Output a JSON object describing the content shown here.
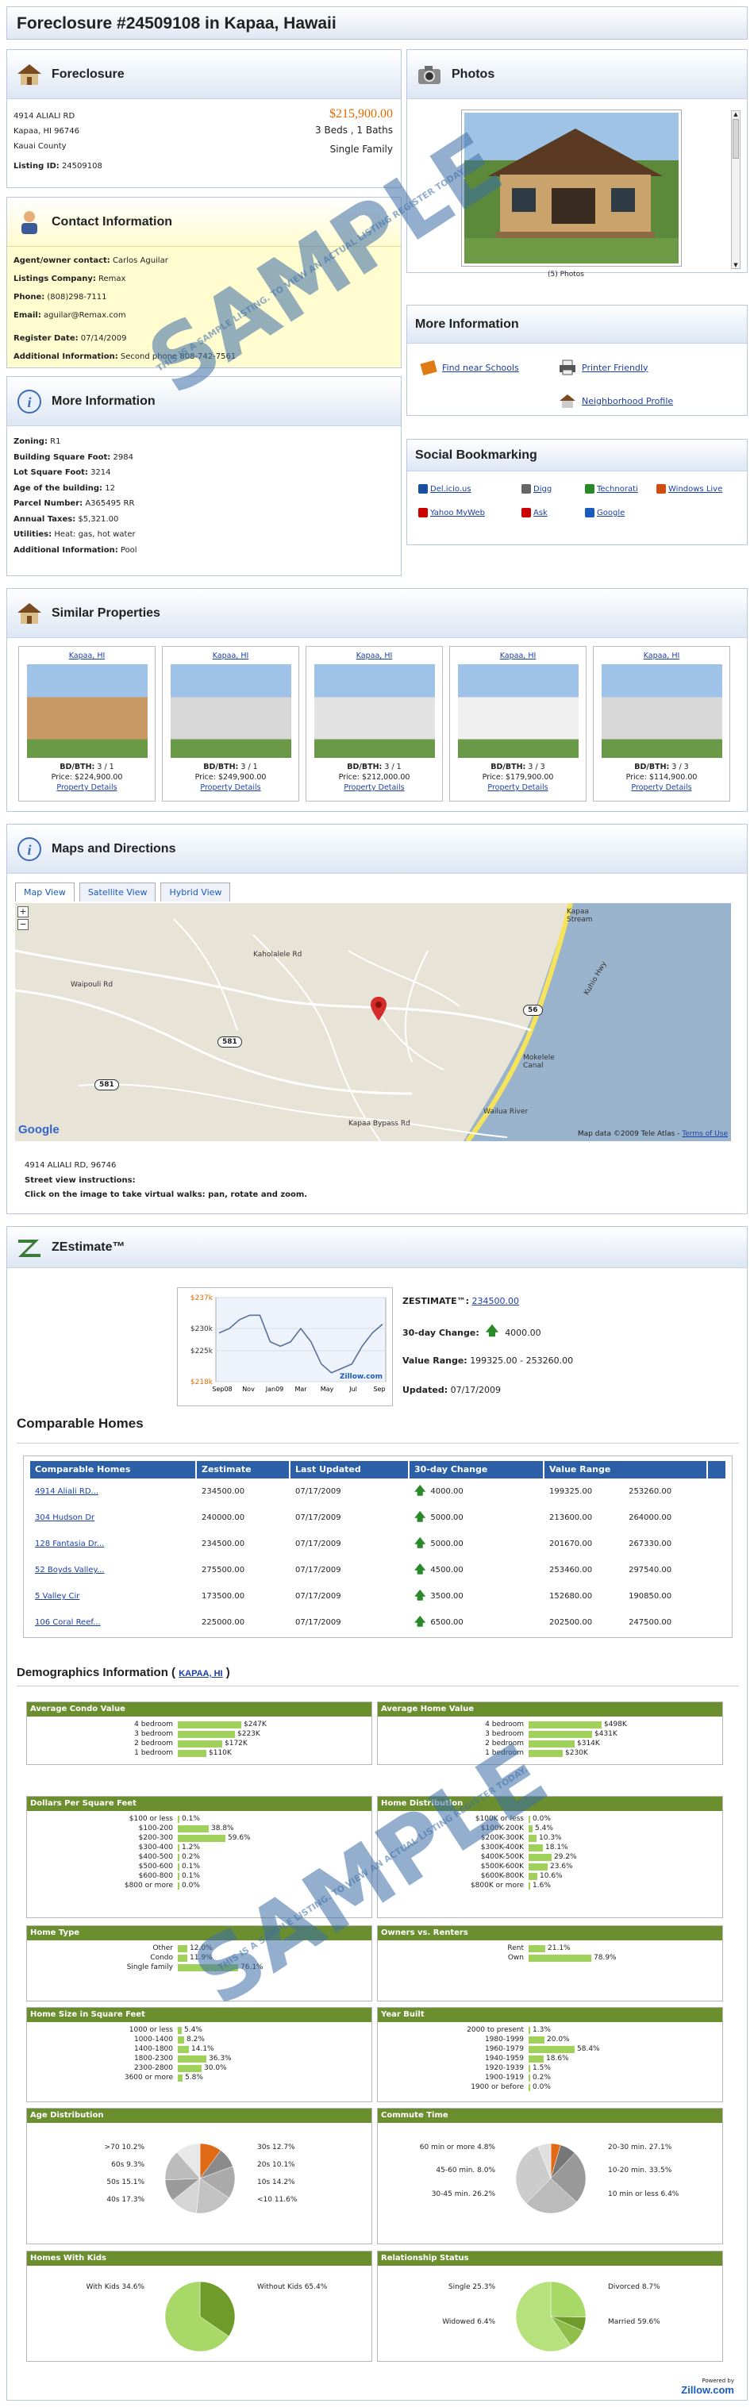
{
  "page_title": "Foreclosure #24509108 in Kapaa, Hawaii",
  "summary": {
    "header": "Foreclosure",
    "address1": "4914 ALIALI RD",
    "address2": "Kapaa, HI 96746",
    "county": "Kauai County",
    "listing_label": "Listing ID:",
    "listing_id": "24509108",
    "price": "$215,900.00",
    "beds_baths": "3 Beds , 1 Baths",
    "type": "Single Family"
  },
  "photos": {
    "header": "Photos",
    "caption": "(5) Photos"
  },
  "contact": {
    "header": "Contact Information",
    "rows": [
      {
        "label": "Agent/owner contact:",
        "value": "Carlos Aguilar"
      },
      {
        "label": "Listings Company:",
        "value": "Remax"
      },
      {
        "label": "Phone:",
        "value": "(808)298-7111"
      },
      {
        "label": "Email:",
        "value": "aguilar@Remax.com"
      },
      {
        "label": "Register Date:",
        "value": "07/14/2009"
      },
      {
        "label": "Additional Information:",
        "value": "Second phone 808-742-7561"
      }
    ]
  },
  "more_info_links": {
    "header": "More Information",
    "find_schools": "Find near Schools",
    "printer": "Printer Friendly",
    "neighborhood": "Neighborhood Profile"
  },
  "more_info": {
    "header": "More Information",
    "rows": [
      {
        "label": "Zoning:",
        "value": "R1"
      },
      {
        "label": "Building Square Foot:",
        "value": "2984"
      },
      {
        "label": "Lot Square Foot:",
        "value": "3214"
      },
      {
        "label": "Age of the building:",
        "value": "12"
      },
      {
        "label": "Parcel Number:",
        "value": "A365495 RR"
      },
      {
        "label": "Annual Taxes:",
        "value": "$5,321.00"
      },
      {
        "label": "Utilities:",
        "value": "Heat: gas, hot water"
      },
      {
        "label": "Additional Information:",
        "value": "Pool"
      }
    ]
  },
  "social": {
    "header": "Social Bookmarking",
    "items": [
      "Del.icio.us",
      "Digg",
      "Technorati",
      "Windows Live",
      "Yahoo MyWeb",
      "Ask",
      "Google"
    ]
  },
  "similar": {
    "header": "Similar Properties",
    "items": [
      {
        "city": "Kapaa, HI",
        "bdbth": "3 / 1",
        "price": "$224,900.00"
      },
      {
        "city": "Kapaa, HI",
        "bdbth": "3 / 1",
        "price": "$249,900.00"
      },
      {
        "city": "Kapaa, HI",
        "bdbth": "3 / 1",
        "price": "$212,000.00"
      },
      {
        "city": "Kapaa, HI",
        "bdbth": "3 / 3",
        "price": "$179,900.00"
      },
      {
        "city": "Kapaa, HI",
        "bdbth": "3 / 3",
        "price": "$114,900.00"
      }
    ],
    "bd_label": "BD/BTH:",
    "price_label": "Price:",
    "details_label": "Property Details"
  },
  "maps": {
    "header": "Maps and Directions",
    "tabs": [
      "Map View",
      "Satellite View",
      "Hybrid View"
    ],
    "labels": [
      "Kapaa Stream",
      "Kuhio Hwy",
      "Wailua River",
      "Waipouli Rd",
      "Kaholalele Rd",
      "Kapaa Bypass Rd",
      "Mokelele Canal"
    ],
    "road_badges": [
      "56",
      "581",
      "581"
    ],
    "copyright": "Map data ©2009 Tele Atlas -",
    "terms": "Terms of Use",
    "google": "Google",
    "address": "4914 ALIALI RD, 96746",
    "instructions_title": "Street view instructions:",
    "instructions": "Click on the image to take virtual walks: pan, rotate and zoom."
  },
  "zestimate": {
    "header": "ZEstimate™",
    "label": "ZESTIMATE™:",
    "value": "234500.00",
    "change_label": "30-day Change:",
    "change": "4000.00",
    "range_label": "Value Range:",
    "range": "199325.00 - 253260.00",
    "updated_label": "Updated:",
    "updated": "07/17/2009",
    "chart_brand": "Zillow.com"
  },
  "chart_data": {
    "type": "line",
    "x": [
      "Sep08",
      "Nov",
      "Jan09",
      "Mar",
      "May",
      "Jul",
      "Sep"
    ],
    "y_ticks": [
      "$237k",
      "$230k",
      "$225k",
      "$218k"
    ],
    "ylim": [
      218,
      237
    ],
    "values": [
      229,
      230,
      232,
      233,
      233,
      227,
      226,
      227,
      230,
      227,
      222,
      220,
      221,
      222,
      226,
      229,
      231
    ]
  },
  "comparables": {
    "header": "Comparable Homes",
    "columns": [
      "Comparable Homes",
      "Zestimate",
      "Last Updated",
      "30-day Change",
      "Value Range"
    ],
    "rows": [
      {
        "name": "4914 Aliali RD...",
        "z": "234500.00",
        "u": "07/17/2009",
        "c": "4000.00",
        "lo": "199325.00",
        "hi": "253260.00"
      },
      {
        "name": "304 Hudson Dr",
        "z": "240000.00",
        "u": "07/17/2009",
        "c": "5000.00",
        "lo": "213600.00",
        "hi": "264000.00"
      },
      {
        "name": "128 Fantasia Dr...",
        "z": "234500.00",
        "u": "07/17/2009",
        "c": "5000.00",
        "lo": "201670.00",
        "hi": "267330.00"
      },
      {
        "name": "52 Boyds Valley...",
        "z": "275500.00",
        "u": "07/17/2009",
        "c": "4500.00",
        "lo": "253460.00",
        "hi": "297540.00"
      },
      {
        "name": "5 Valley Cir",
        "z": "173500.00",
        "u": "07/17/2009",
        "c": "3500.00",
        "lo": "152680.00",
        "hi": "190850.00"
      },
      {
        "name": "106 Coral Reef...",
        "z": "225000.00",
        "u": "07/17/2009",
        "c": "6500.00",
        "lo": "202500.00",
        "hi": "247500.00"
      }
    ]
  },
  "demographics": {
    "header": "Demographics Information (",
    "link": "KAPAA, HI",
    "close": ")",
    "groups": [
      {
        "title": "Average Condo Value",
        "rows": [
          [
            "4 bedroom",
            0.8,
            "$247K"
          ],
          [
            "3 bedroom",
            0.72,
            "$223K"
          ],
          [
            "2 bedroom",
            0.56,
            "$172K"
          ],
          [
            "1 bedroom",
            0.36,
            "$110K"
          ]
        ]
      },
      {
        "title": "Average Home Value",
        "rows": [
          [
            "4 bedroom",
            0.92,
            "$498K"
          ],
          [
            "3 bedroom",
            0.8,
            "$431K"
          ],
          [
            "2 bedroom",
            0.58,
            "$314K"
          ],
          [
            "1 bedroom",
            0.43,
            "$230K"
          ]
        ]
      },
      {
        "title": "Dollars Per Square Feet",
        "rows": [
          [
            "$100 or less",
            0.02,
            "0.1%"
          ],
          [
            "$100-200",
            0.39,
            "38.8%"
          ],
          [
            "$200-300",
            0.6,
            "59.6%"
          ],
          [
            "$300-400",
            0.02,
            "1.2%"
          ],
          [
            "$400-500",
            0.01,
            "0.2%"
          ],
          [
            "$500-600",
            0.01,
            "0.1%"
          ],
          [
            "$600-800",
            0.01,
            "0.1%"
          ],
          [
            "$800 or more",
            0.01,
            "0.0%"
          ]
        ]
      },
      {
        "title": "Home Distribution",
        "rows": [
          [
            "$100K or less",
            0.01,
            "0.0%"
          ],
          [
            "$100K-200K",
            0.05,
            "5.4%"
          ],
          [
            "$200K-300K",
            0.1,
            "10.3%"
          ],
          [
            "$300K-400K",
            0.18,
            "18.1%"
          ],
          [
            "$400K-500K",
            0.29,
            "29.2%"
          ],
          [
            "$500K-600K",
            0.24,
            "23.6%"
          ],
          [
            "$600K-800K",
            0.11,
            "10.6%"
          ],
          [
            "$800K or more",
            0.02,
            "1.6%"
          ]
        ]
      },
      {
        "title": "Home Type",
        "rows": [
          [
            "Other",
            0.12,
            "12.0%"
          ],
          [
            "Condo",
            0.12,
            "11.9%"
          ],
          [
            "Single family",
            0.76,
            "76.1%"
          ]
        ]
      },
      {
        "title": "Owners vs. Renters",
        "rows": [
          [
            "Rent",
            0.21,
            "21.1%"
          ],
          [
            "Own",
            0.79,
            "78.9%"
          ]
        ]
      },
      {
        "title": "Home Size in Square Feet",
        "rows": [
          [
            "1000 or less",
            0.05,
            "5.4%"
          ],
          [
            "1000-1400",
            0.08,
            "8.2%"
          ],
          [
            "1400-1800",
            0.14,
            "14.1%"
          ],
          [
            "1800-2300",
            0.36,
            "36.3%"
          ],
          [
            "2300-2800",
            0.3,
            "30.0%"
          ],
          [
            "3600 or more",
            0.06,
            "5.8%"
          ]
        ]
      },
      {
        "title": "Year Built",
        "rows": [
          [
            "2000 to present",
            0.01,
            "1.3%"
          ],
          [
            "1980-1999",
            0.2,
            "20.0%"
          ],
          [
            "1960-1979",
            0.58,
            "58.4%"
          ],
          [
            "1940-1959",
            0.19,
            "18.6%"
          ],
          [
            "1920-1939",
            0.02,
            "1.5%"
          ],
          [
            "1900-1919",
            0.01,
            "0.2%"
          ],
          [
            "1900 or before",
            0.01,
            "0.0%"
          ]
        ]
      }
    ],
    "pies": [
      {
        "title": "Age Distribution",
        "labels": [
          ">70 10.2%",
          "60s 9.3%",
          "50s 15.1%",
          "40s 17.3%",
          "30s 12.7%",
          "20s 10.1%",
          "10s 14.2%",
          "<10 11.6%"
        ],
        "values": [
          10.2,
          9.3,
          15.1,
          17.3,
          12.7,
          10.1,
          14.2,
          11.6
        ]
      },
      {
        "title": "Commute Time",
        "labels": [
          "60 min or more 4.8%",
          "45-60 min. 8.0%",
          "30-45 min. 26.2%",
          "20-30 min. 27.1%",
          "10-20 min. 33.5%",
          "10 min or less 6.4%"
        ],
        "values": [
          4.8,
          8.0,
          26.2,
          27.1,
          33.5,
          6.4
        ]
      },
      {
        "title": "Homes With Kids",
        "labels": [
          "With Kids 34.6%",
          "Without Kids 65.4%"
        ],
        "values": [
          34.6,
          65.4
        ]
      },
      {
        "title": "Relationship Status",
        "labels": [
          "Single 25.3%",
          "Widowed 6.4%",
          "Divorced 8.7%",
          "Married 59.6%"
        ],
        "values": [
          25.3,
          6.4,
          8.7,
          59.6
        ]
      }
    ]
  },
  "footer": {
    "powered": "Powered by",
    "brand": "Zillow.com"
  },
  "watermark": {
    "big": "SAMPLE",
    "small": "THIS IS A SAMPLE LISTING. TO VIEW AN ACTUAL LISTING REGISTER TODAY."
  },
  "colors": {
    "accent": "#1a3fa8",
    "price": "#e06c00",
    "table_header": "#2b5fa8",
    "demog_header": "#6b8e2f",
    "bar": "#9fd15b"
  }
}
